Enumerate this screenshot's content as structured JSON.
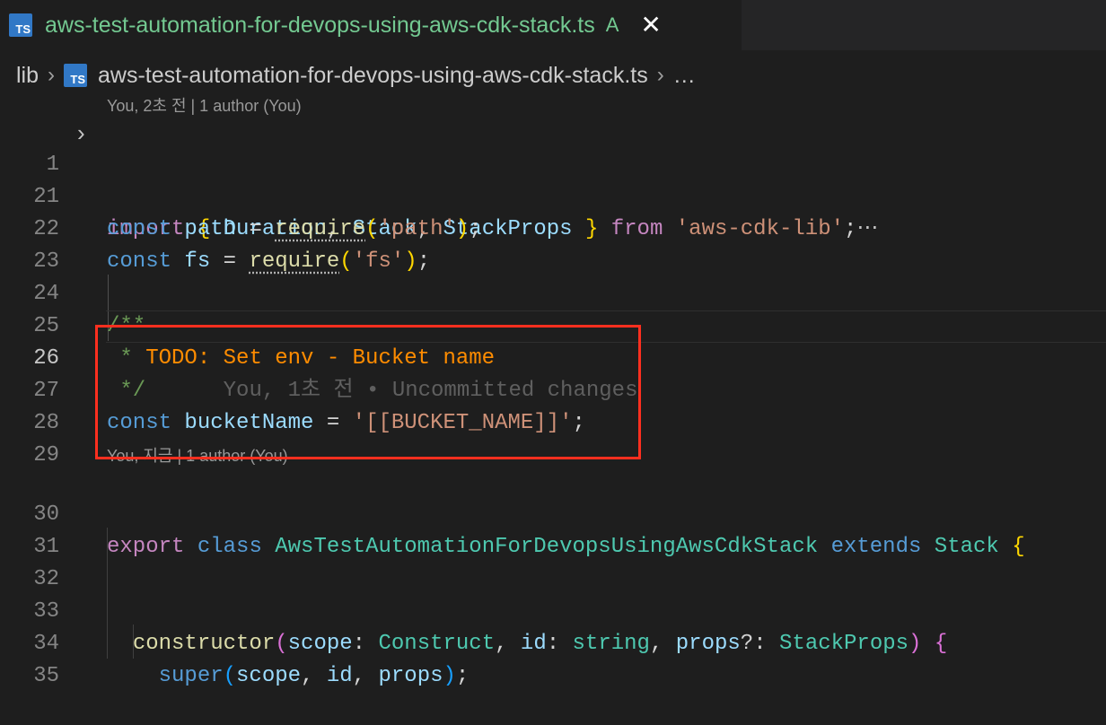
{
  "tab": {
    "icon": "TS",
    "title": "aws-test-automation-for-devops-using-aws-cdk-stack.ts",
    "status": "A",
    "close": "✕"
  },
  "breadcrumb": {
    "folder": "lib",
    "file": "aws-test-automation-for-devops-using-aws-cdk-stack.ts",
    "more": "…"
  },
  "lens": {
    "top": "You, 2초 전 | 1 author (You)",
    "class": "You, 지금 | 1 author (You)"
  },
  "line_numbers": [
    "1",
    "21",
    "22",
    "23",
    "24",
    "25",
    "26",
    "27",
    "28",
    "29",
    "30",
    "31",
    "32",
    "33",
    "34",
    "35"
  ],
  "code": {
    "l1": {
      "import": "import",
      "ob": "{",
      "d": "Duration",
      "c1": ",",
      "s": "Stack",
      "c2": ",",
      "sp": "StackProps",
      "cb": "}",
      "from": "from",
      "mod": "'aws-cdk-lib'",
      "semi": ";",
      "more": "⋯"
    },
    "l21": {
      "kw": "const",
      "name": "path",
      "eq": "=",
      "fn": "require",
      "op": "(",
      "str": "'path'",
      "cp": ")",
      "semi": ";"
    },
    "l22": {
      "kw": "const",
      "name": "fs",
      "eq": "=",
      "fn": "require",
      "op": "(",
      "str": "'fs'",
      "cp": ")",
      "semi": ";"
    },
    "l24": "/**",
    "l25": {
      "star": " *",
      "todo": "TODO: Set env - Bucket name"
    },
    "l26": {
      "end": " */",
      "blame": "You, 1초 전 • Uncommitted changes"
    },
    "l27": {
      "kw": "const",
      "name": "bucketName",
      "eq": "=",
      "str": "'[[BUCKET_NAME]]'",
      "semi": ";"
    },
    "l30": {
      "export": "export",
      "class": "class",
      "name": "AwsTestAutomationForDevopsUsingAwsCdkStack",
      "extends": "extends",
      "base": "Stack",
      "ob": "{"
    },
    "l33": {
      "fn": "constructor",
      "op": "(",
      "p1": "scope",
      "col1": ":",
      "t1": "Construct",
      "c1": ",",
      "p2": "id",
      "col2": ":",
      "t2": "string",
      "c2": ",",
      "p3": "props",
      "q": "?:",
      "t3": "StackProps",
      "cp": ")",
      "ob": "{"
    },
    "l34": {
      "fn": "super",
      "op": "(",
      "a1": "scope",
      "c1": ",",
      "a2": "id",
      "c2": ",",
      "a3": "props",
      "cp": ")",
      "semi": ";"
    }
  },
  "colors": {
    "highlight_box": "#ff2f1f",
    "tab_title": "#73c991"
  }
}
